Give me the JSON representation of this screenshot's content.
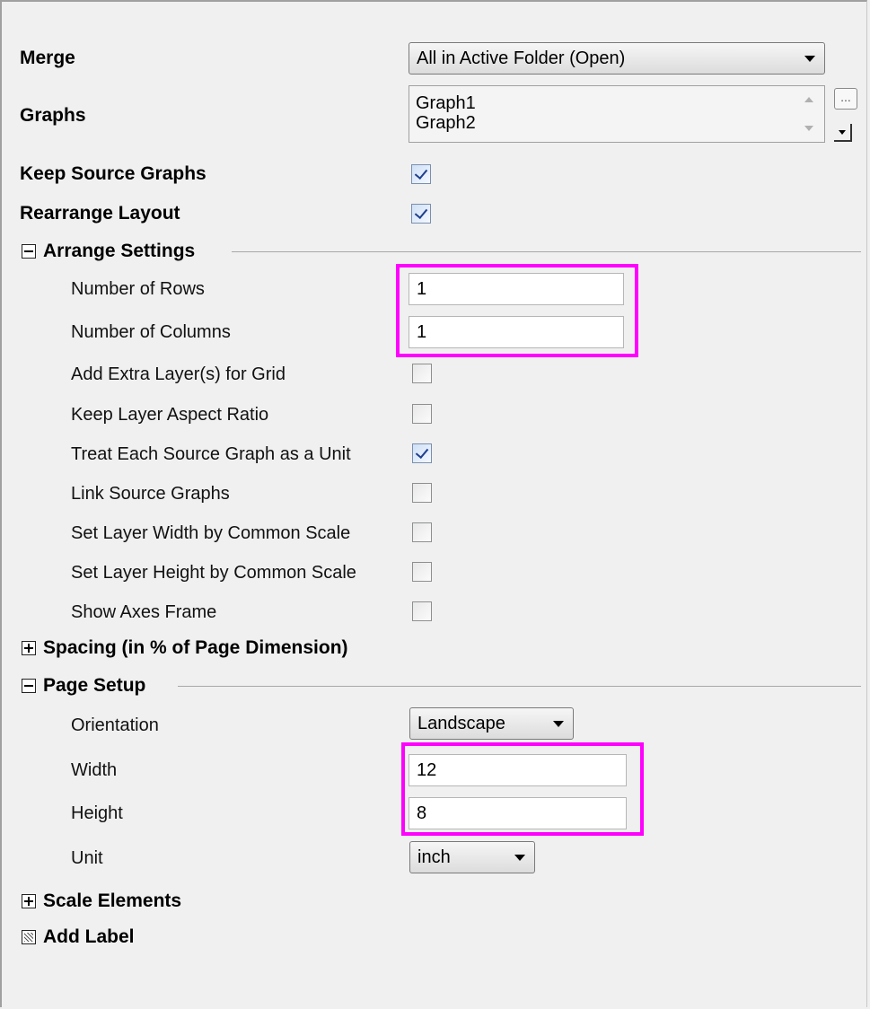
{
  "merge": {
    "label": "Merge",
    "value": "All in Active Folder (Open)"
  },
  "graphs": {
    "label": "Graphs",
    "items": [
      "Graph1",
      "Graph2"
    ],
    "browse_label": "..."
  },
  "keep_source_graphs": {
    "label": "Keep Source Graphs",
    "checked": true
  },
  "rearrange_layout": {
    "label": "Rearrange Layout",
    "checked": true
  },
  "arrange_settings": {
    "title": "Arrange Settings",
    "expanded": true,
    "number_of_rows": {
      "label": "Number of Rows",
      "value": "1"
    },
    "number_of_columns": {
      "label": "Number of Columns",
      "value": "1"
    },
    "checkboxes": [
      {
        "label": "Add Extra Layer(s) for Grid",
        "checked": false
      },
      {
        "label": "Keep Layer Aspect Ratio",
        "checked": false
      },
      {
        "label": "Treat Each Source Graph as a Unit",
        "checked": true
      },
      {
        "label": "Link Source Graphs",
        "checked": false
      },
      {
        "label": "Set Layer Width by Common Scale",
        "checked": false
      },
      {
        "label": "Set Layer Height by Common Scale",
        "checked": false
      },
      {
        "label": "Show Axes Frame",
        "checked": false
      }
    ]
  },
  "spacing": {
    "title": "Spacing (in % of Page Dimension)",
    "expanded": false
  },
  "page_setup": {
    "title": "Page Setup",
    "expanded": true,
    "orientation": {
      "label": "Orientation",
      "value": "Landscape"
    },
    "width": {
      "label": "Width",
      "value": "12"
    },
    "height": {
      "label": "Height",
      "value": "8"
    },
    "unit": {
      "label": "Unit",
      "value": "inch"
    }
  },
  "scale_elements": {
    "title": "Scale Elements",
    "expanded": false
  },
  "add_label": {
    "title": "Add Label"
  },
  "colors": {
    "highlight": "#ff00ff",
    "background": "#f0f0f0",
    "check": "#1f3f8f"
  }
}
